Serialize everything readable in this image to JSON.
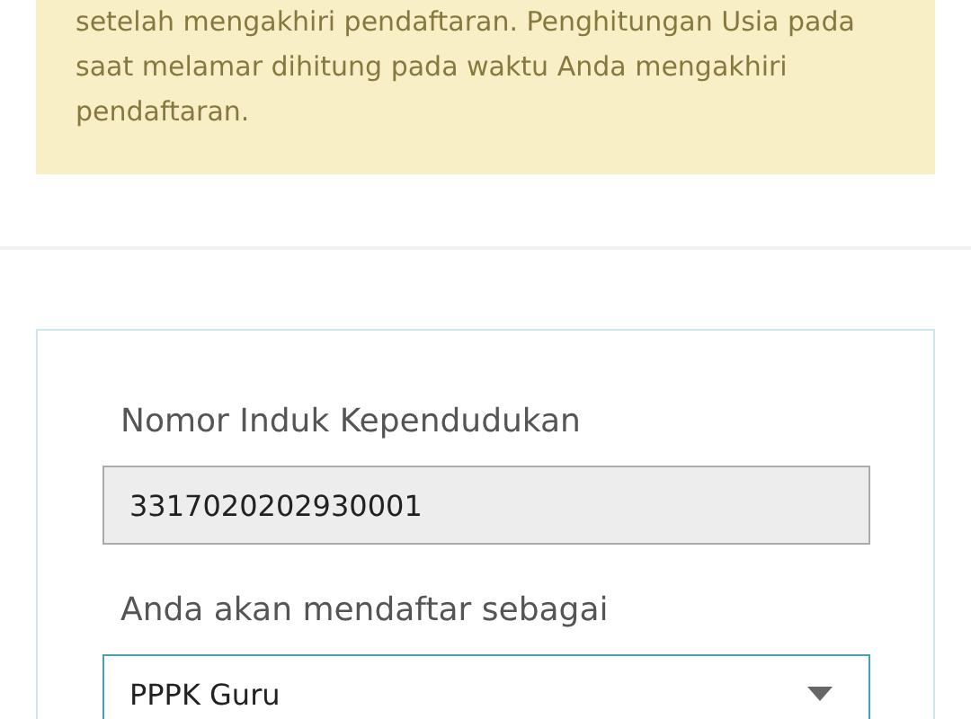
{
  "notice": {
    "text": "setelah mengakhiri pendaftaran. Penghitungan Usia pada saat melamar dihitung pada waktu Anda mengakhiri pendaftaran."
  },
  "form": {
    "fields": [
      {
        "kind": "text",
        "label": "Nomor Induk Kependudukan",
        "value": "3317020202930001",
        "disabled": true
      },
      {
        "kind": "select",
        "label": "Anda akan mendaftar sebagai",
        "value": "PPPK Guru",
        "disabled": false
      }
    ]
  }
}
